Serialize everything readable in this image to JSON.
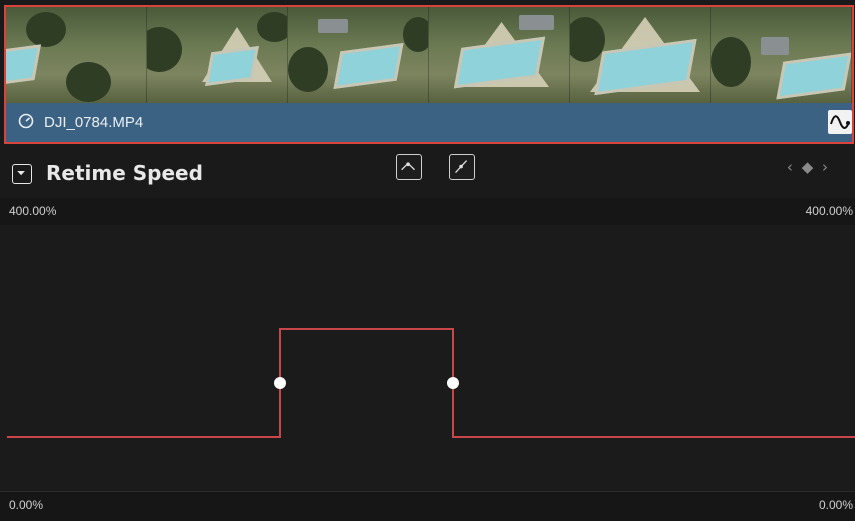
{
  "clip": {
    "name": "DJI_0784.MP4",
    "frames": 6
  },
  "header": {
    "title": "Retime Speed",
    "keyframe_nav": "‹ ◆ ›"
  },
  "axis": {
    "max_left": "400.00%",
    "max_right": "400.00%",
    "min_left": "0.00%",
    "min_right": "0.00%"
  },
  "curve": {
    "baseline_pct": 100,
    "peak_pct": 200,
    "keyframe_count": 2
  },
  "colors": {
    "curve": "#c8474a",
    "clip_border": "#d8443c",
    "clip_bar": "#3c6283"
  }
}
